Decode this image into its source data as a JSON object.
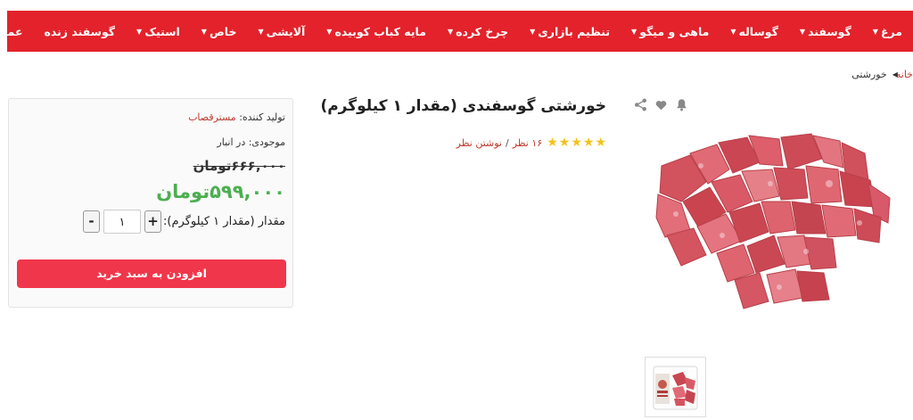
{
  "nav": {
    "items": [
      {
        "label": "مرغ",
        "dropdown": true
      },
      {
        "label": "گوسفند",
        "dropdown": true
      },
      {
        "label": "گوساله",
        "dropdown": true
      },
      {
        "label": "ماهی و میگو",
        "dropdown": true
      },
      {
        "label": "تنظیم بازاری",
        "dropdown": true
      },
      {
        "label": "چرخ کرده",
        "dropdown": true
      },
      {
        "label": "مایه کباب کوبیده",
        "dropdown": true
      },
      {
        "label": "آلایشی",
        "dropdown": true
      },
      {
        "label": "خاص",
        "dropdown": true
      },
      {
        "label": "استیک",
        "dropdown": true
      },
      {
        "label": "گوسفند زنده",
        "dropdown": false
      },
      {
        "label": "عمده فروشی",
        "dropdown": true
      }
    ],
    "bg_color": "#e3222b"
  },
  "breadcrumb": {
    "home": "خانه",
    "current": "خورشتی"
  },
  "product": {
    "title": "خورشتی گوسفندی (مقدار ۱ کیلوگرم)",
    "rating": 5,
    "reviews_count": "۱۶ نظر",
    "separator": "/",
    "write_review": "نوشتن نظر"
  },
  "buybox": {
    "manufacturer_label": "تولید کننده:",
    "manufacturer_value": "مسترقصاب",
    "stock_label": "موجودی:",
    "stock_value": "در انبار",
    "old_price": "۶۶۶,۰۰۰تومان",
    "new_price": "۵۹۹,۰۰۰تومان",
    "quantity_label": "مقدار (مقدار ۱ کیلوگرم):",
    "quantity_value": "۱",
    "plus": "+",
    "minus": "-",
    "add_to_cart": "افزودن به سبد خرید",
    "accent_color": "#f0364a",
    "price_color": "#4caf50"
  },
  "icons": [
    "share-icon",
    "heart-icon",
    "bell-icon"
  ]
}
